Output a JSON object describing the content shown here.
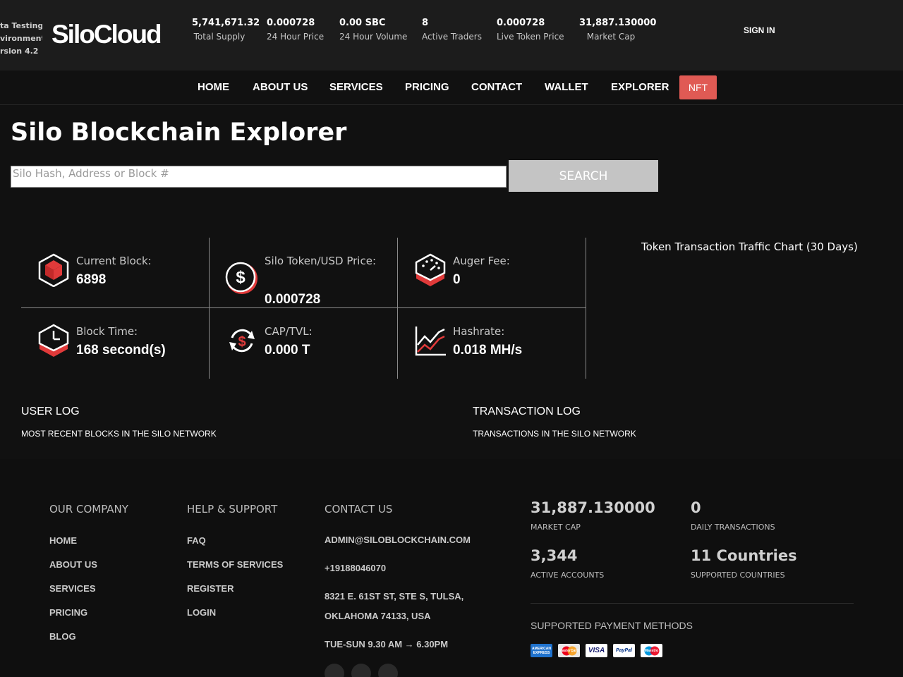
{
  "env": {
    "line1": "ta Testing",
    "line2": "vironment",
    "line3": "rsion 4.2"
  },
  "logo": "SiloCloud",
  "stats": [
    {
      "value": "5,741,671.32",
      "label": "Total Supply"
    },
    {
      "value": "0.000728",
      "label": "24 Hour Price"
    },
    {
      "value": "0.00 SBC",
      "label": "24 Hour Volume"
    },
    {
      "value": "8",
      "label": "Active Traders"
    },
    {
      "value": "0.000728",
      "label": "Live Token Price"
    },
    {
      "value": "31,887.130000",
      "label": "Market Cap"
    }
  ],
  "sign_in": "SIGN IN",
  "nav": [
    "HOME",
    "ABOUT US",
    "SERVICES",
    "PRICING",
    "CONTACT",
    "WALLET",
    "EXPLORER",
    "NFT"
  ],
  "page_title": "Silo Blockchain Explorer",
  "search": {
    "placeholder": "Silo Hash, Address or Block #",
    "button": "SEARCH"
  },
  "grid": {
    "current_block": {
      "label": "Current Block:",
      "value": "6898",
      "icon": "cube-icon"
    },
    "token_usd": {
      "label": "Silo Token/USD Price:",
      "value": "0.000728",
      "icon": "dollar-coin-icon"
    },
    "auger_fee": {
      "label": "Auger Fee:",
      "value": "0",
      "icon": "gauge-icon"
    },
    "block_time": {
      "label": "Block Time:",
      "value": "168 second(s)",
      "icon": "clock-icon"
    },
    "cap_tvl": {
      "label": "CAP/TVL:",
      "value": "0.000 T",
      "icon": "exchange-dollar-icon"
    },
    "hashrate": {
      "label": "Hashrate:",
      "value": "0.018 MH/s",
      "icon": "line-chart-icon"
    }
  },
  "chart_title": "Token Transaction Traffic Chart (30 Days)",
  "user_log": {
    "title": "USER LOG",
    "subtitle": "MOST RECENT BLOCKS IN THE SILO NETWORK"
  },
  "transaction_log": {
    "title": "TRANSACTION LOG",
    "subtitle": "TRANSACTIONS IN THE SILO NETWORK"
  },
  "footer": {
    "company": {
      "title": "OUR COMPANY",
      "links": [
        "HOME",
        "ABOUT US",
        "SERVICES",
        "PRICING",
        "BLOG"
      ]
    },
    "help": {
      "title": "HELP & SUPPORT",
      "links": [
        "FAQ",
        "TERMS OF SERVICES",
        "REGISTER",
        "LOGIN"
      ]
    },
    "contact": {
      "title": "CONTACT US",
      "email": "ADMIN@SILOBLOCKCHAIN.COM",
      "phone": "+19188046070",
      "address1": "8321 E. 61ST ST, STE S, TULSA,",
      "address2": "OKLAHOMA 74133, USA",
      "hours": "TUE-SUN 9.30 AM → 6.30PM"
    },
    "metrics": [
      {
        "value": "31,887.130000",
        "label": "MARKET CAP"
      },
      {
        "value": "0",
        "label": "DAILY TRANSACTIONS"
      },
      {
        "value": "3,344",
        "label": "ACTIVE ACCOUNTS"
      },
      {
        "value": "11 Countries",
        "label": "SUPPORTED COUNTRIES"
      }
    ],
    "payment_title": "SUPPORTED PAYMENT METHODS",
    "payment_methods": [
      {
        "name": "AMERICAN EXPRESS",
        "color": "#1f72cd"
      },
      {
        "name": "MasterCard",
        "color": "#e8e8e8"
      },
      {
        "name": "VISA",
        "color": "#ffffff"
      },
      {
        "name": "PayPal",
        "color": "#ffffff"
      },
      {
        "name": "Maestro",
        "color": "#ffffff"
      }
    ]
  },
  "colors": {
    "accent_red": "#e03a3a",
    "nft_button": "#e05a54",
    "search_button": "#c4c4c4"
  }
}
